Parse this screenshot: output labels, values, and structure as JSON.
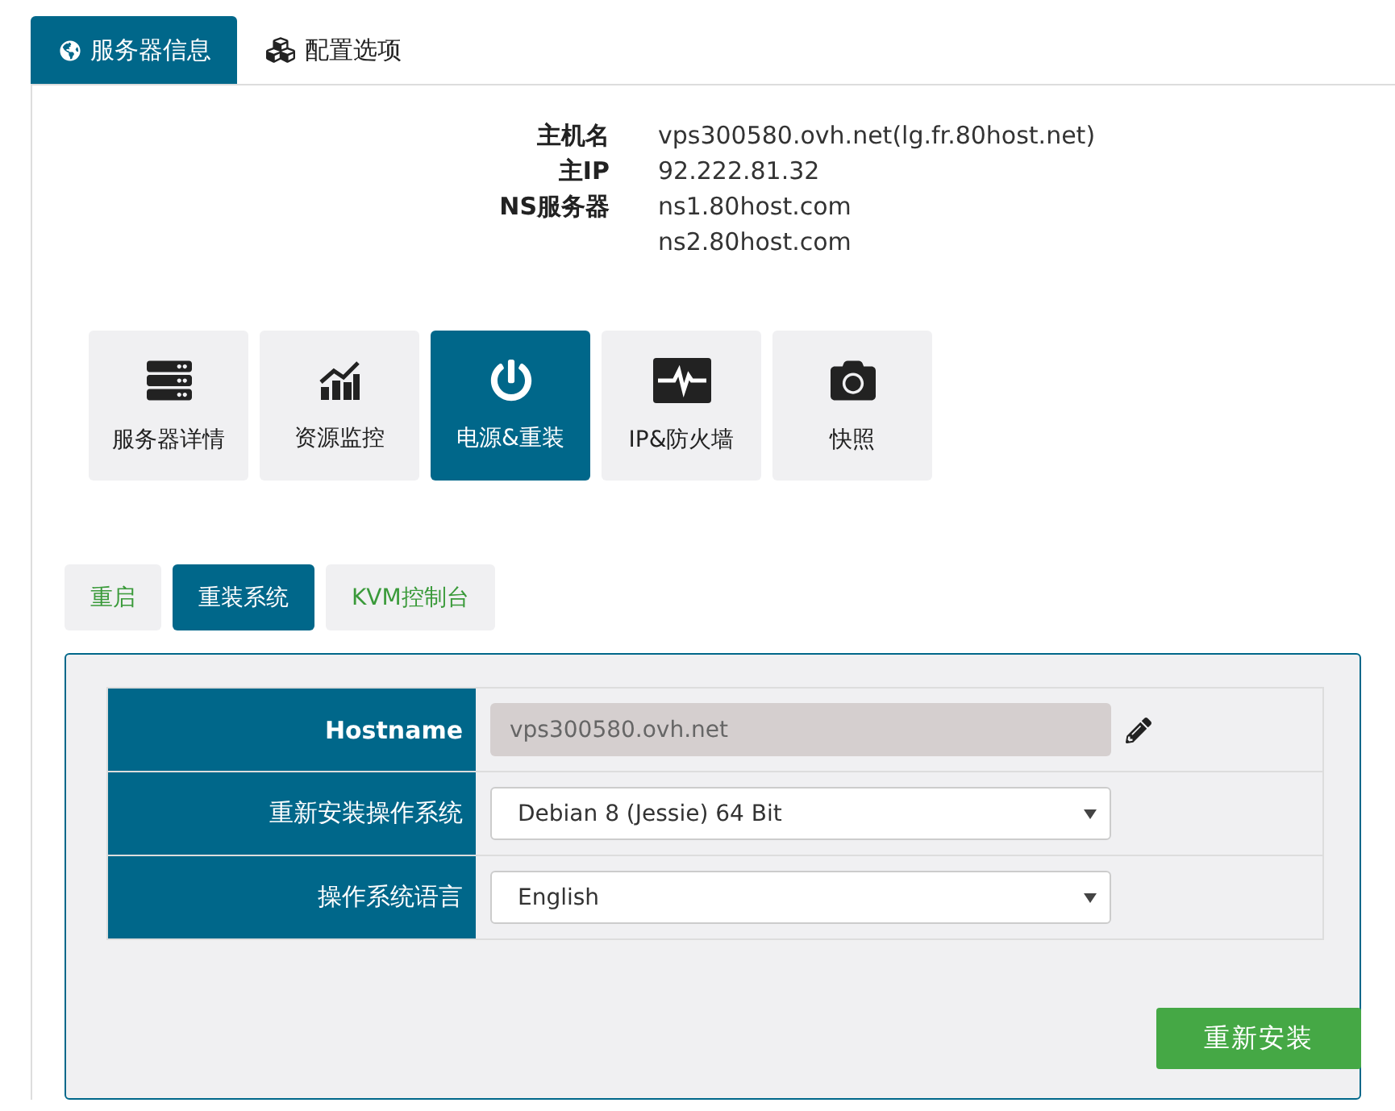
{
  "top_tabs": [
    {
      "label": "服务器信息",
      "selected": true
    },
    {
      "label": "配置选项",
      "selected": false
    }
  ],
  "server_info": [
    {
      "label": "主机名",
      "values": [
        "vps300580.ovh.net(lg.fr.80host.net)"
      ]
    },
    {
      "label": "主IP",
      "values": [
        "92.222.81.32"
      ]
    },
    {
      "label": "NS服务器",
      "values": [
        "ns1.80host.com",
        "ns2.80host.com"
      ]
    }
  ],
  "tiles": [
    {
      "label": "服务器详情",
      "selected": false
    },
    {
      "label": "资源监控",
      "selected": false
    },
    {
      "label": "电源&重装",
      "selected": true
    },
    {
      "label": "IP&防火墙",
      "selected": false
    },
    {
      "label": "快照",
      "selected": false
    }
  ],
  "sub_tabs": [
    {
      "label": "重启",
      "selected": false
    },
    {
      "label": "重装系统",
      "selected": true
    },
    {
      "label": "KVM控制台",
      "selected": false
    }
  ],
  "form": {
    "rows": [
      {
        "kind": "readonly",
        "label": "Hostname",
        "value": "vps300580.ovh.net"
      },
      {
        "kind": "select",
        "label": "重新安装操作系统",
        "value": "Debian 8 (Jessie) 64 Bit"
      },
      {
        "kind": "select",
        "label": "操作系统语言",
        "value": "English"
      }
    ],
    "submit": "重新安装"
  }
}
